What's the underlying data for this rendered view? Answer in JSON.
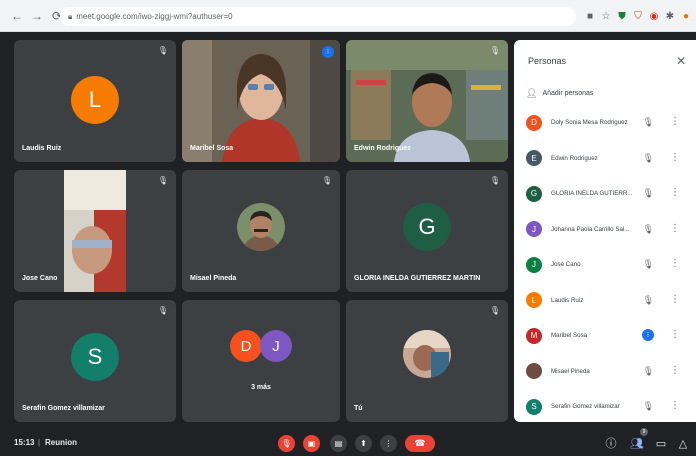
{
  "browser": {
    "url": "meet.google.com/iwo-ziggj-wmi?authuser=0"
  },
  "tiles": [
    {
      "name": "Laudis Ruiz",
      "initial": "L",
      "color": "#f57c00"
    },
    {
      "name": "Maribel Sosa"
    },
    {
      "name": "Edwin Rodriguez"
    },
    {
      "name": "Jose Cano"
    },
    {
      "name": "Misael Pineda"
    },
    {
      "name": "GLORIA INELDA GUTIERREZ MARTIN",
      "initial": "G",
      "color": "#1e5e44"
    },
    {
      "name": "Serafin Gomez villamizar",
      "initial": "S",
      "color": "#137e6a"
    },
    {
      "name": "3 más",
      "initials": [
        "D",
        "J"
      ],
      "colors": [
        "#f4511e",
        "#7e57c2"
      ]
    },
    {
      "name": "Tú"
    }
  ],
  "people_panel": {
    "title": "Personas",
    "add_label": "Añadir personas",
    "participants": [
      {
        "name": "Doly Sonia Mesa Rodriguez",
        "initial": "D",
        "color": "#f4511e"
      },
      {
        "name": "Edwin Rodriguez",
        "initial": "E",
        "color": "#455a64"
      },
      {
        "name": "GLORIA INELDA GUTIERR...",
        "initial": "G",
        "color": "#1e5e44"
      },
      {
        "name": "Johanna Paola Carrillo Sal...",
        "initial": "J",
        "color": "#7e57c2"
      },
      {
        "name": "Jose Cano",
        "initial": "J",
        "color": "#0b8043"
      },
      {
        "name": "Laudis Ruiz",
        "initial": "L",
        "color": "#f57c00"
      },
      {
        "name": "Maribel Sosa",
        "initial": "M",
        "color": "#c62828"
      },
      {
        "name": "Misael Pineda",
        "initial": "",
        "color": "#6d4c41"
      },
      {
        "name": "Serafin Gomez villamizar",
        "initial": "S",
        "color": "#137e6a"
      }
    ]
  },
  "bottom_bar": {
    "time": "15:13",
    "separator": "|",
    "meeting_name": "Reunion",
    "participant_count": "9"
  },
  "colors": {
    "background": "#202124",
    "tile": "#3c4043",
    "accent_blue": "#1a73e8",
    "danger_red": "#ea4335"
  },
  "icons": {
    "mic_off": "mic-off-icon",
    "camera_off": "camera-off-icon",
    "captions": "captions-icon",
    "present": "present-icon",
    "more": "more-vert-icon",
    "leave": "call-end-icon",
    "info": "info-icon",
    "people": "people-icon",
    "chat": "chat-icon",
    "activities": "activities-icon"
  }
}
